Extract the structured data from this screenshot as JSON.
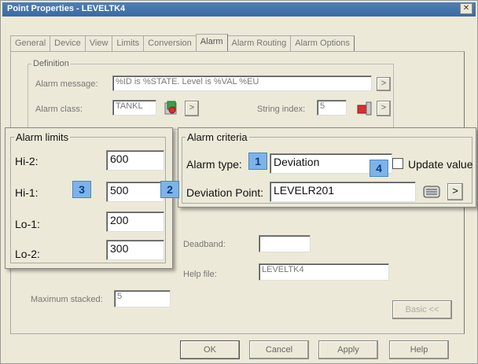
{
  "window": {
    "title": "Point Properties - LEVELTK4"
  },
  "tabs": [
    "General",
    "Device",
    "View",
    "Limits",
    "Conversion",
    "Alarm",
    "Alarm Routing",
    "Alarm Options"
  ],
  "active_tab": "Alarm",
  "definition": {
    "legend": "Definition",
    "alarm_message_label": "Alarm message:",
    "alarm_message_value": "%ID is %STATE. Level is %VAL %EU",
    "alarm_class_label": "Alarm class:",
    "alarm_class_value": "TANKL",
    "string_index_label": "String index:",
    "string_index_value": "5",
    "arrow": ">"
  },
  "alarm_limits": {
    "legend": "Alarm limits",
    "hi2_label": "Hi-2:",
    "hi2_value": "600",
    "hi1_label": "Hi-1:",
    "hi1_value": "500",
    "lo1_label": "Lo-1:",
    "lo1_value": "200",
    "lo2_label": "Lo-2:",
    "lo2_value": "300"
  },
  "alarm_criteria": {
    "legend": "Alarm criteria",
    "alarm_type_label": "Alarm type:",
    "alarm_type_value": "Deviation",
    "update_value_label": "Update value",
    "update_value_checked": false,
    "deviation_point_label": "Deviation Point:",
    "deviation_point_value": "LEVELR201",
    "arrow": ">"
  },
  "callouts": [
    "1",
    "2",
    "3",
    "4"
  ],
  "deadband_label": "Deadband:",
  "deadband_value": "",
  "help_file_label": "Help file:",
  "help_file_value": "LEVELTK4",
  "maximum_stacked_label": "Maximum stacked:",
  "maximum_stacked_value": "5",
  "basic_button": "Basic <<",
  "buttons": {
    "ok": "OK",
    "cancel": "Cancel",
    "apply": "Apply",
    "help": "Help"
  },
  "colors": {
    "titlebar": "#3d6aa0",
    "callout": "#7fb3e6",
    "dialog": "#ece9d8"
  }
}
